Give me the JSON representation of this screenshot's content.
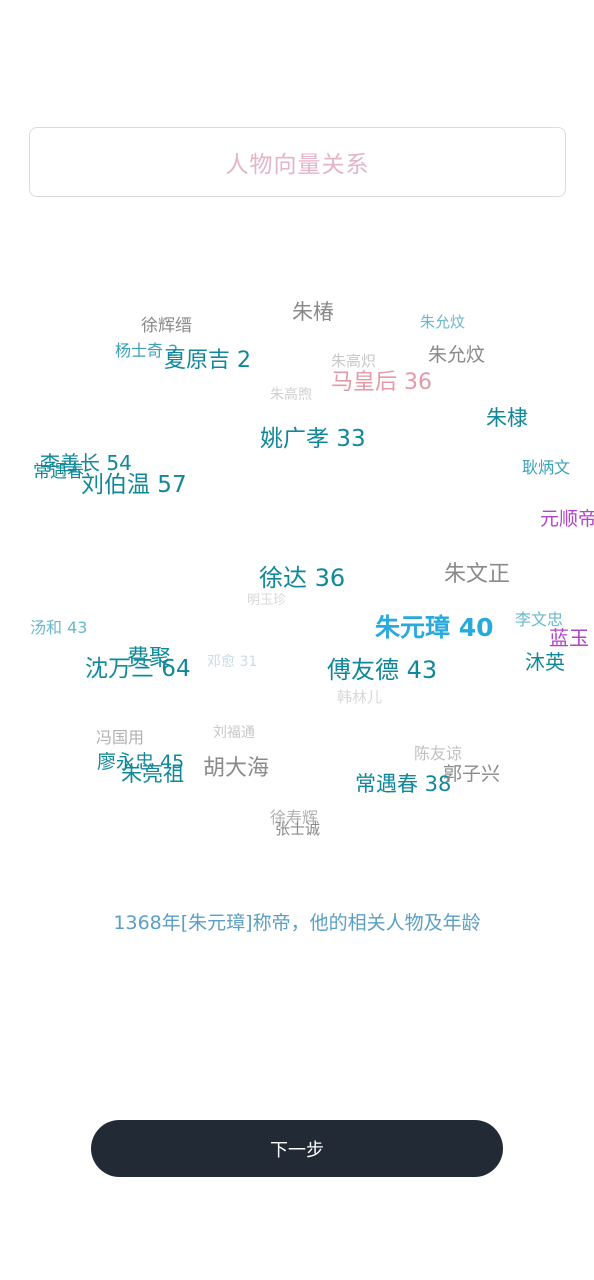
{
  "header": {
    "title": "人物向量关系"
  },
  "caption": "1368年[朱元璋]称帝，他的相关人物及年龄",
  "next_button": {
    "label": "下一步"
  },
  "word_cloud": [
    {
      "text": "朱椿",
      "color": "#8a8a8a"
    },
    {
      "text": "徐辉缙",
      "color": "#8a8a8a"
    },
    {
      "text": "杨士奇 2",
      "color": "#3aa1b8"
    },
    {
      "text": "夏原吉 2",
      "color": "#10889a"
    },
    {
      "text": "朱允炆",
      "color": "#6ab8cc"
    },
    {
      "text": "朱允炆",
      "color": "#8a8a8a"
    },
    {
      "text": "朱高炽",
      "color": "#c8c8c8"
    },
    {
      "text": "马皇后 36",
      "color": "#e39aa8"
    },
    {
      "text": "朱高煦",
      "color": "#d0d0d0"
    },
    {
      "text": "朱棣",
      "color": "#10889a"
    },
    {
      "text": "姚广孝 33",
      "color": "#10889a"
    },
    {
      "text": "李善长 54",
      "color": "#10889a"
    },
    {
      "text": "常遇春",
      "color": "#10889a"
    },
    {
      "text": "刘伯温 57",
      "color": "#10889a"
    },
    {
      "text": "耿炳文",
      "color": "#3aa1b8"
    },
    {
      "text": "元顺帝",
      "color": "#b244c8"
    },
    {
      "text": "徐达 36",
      "color": "#10889a"
    },
    {
      "text": "朱文正",
      "color": "#8a8a8a"
    },
    {
      "text": "明玉珍",
      "color": "#d8d8d8"
    },
    {
      "text": "汤和 43",
      "color": "#6ab8cc"
    },
    {
      "text": "朱元璋 40",
      "color": "#28aadc"
    },
    {
      "text": "李文忠",
      "color": "#6ab8cc"
    },
    {
      "text": "蓝玉",
      "color": "#b244c8"
    },
    {
      "text": "费聚",
      "color": "#10889a"
    },
    {
      "text": "沈万三 64",
      "color": "#10889a"
    },
    {
      "text": "邓愈 31",
      "color": "#c8dce6"
    },
    {
      "text": "傅友德 43",
      "color": "#10889a"
    },
    {
      "text": "沐英",
      "color": "#10889a"
    },
    {
      "text": "韩林儿",
      "color": "#d8d8d8"
    },
    {
      "text": "冯国用",
      "color": "#b0b0b0"
    },
    {
      "text": "刘福通",
      "color": "#c8c8c8"
    },
    {
      "text": "廖永忠 45",
      "color": "#10889a"
    },
    {
      "text": "朱亮祖",
      "color": "#10889a"
    },
    {
      "text": "胡大海",
      "color": "#8a8a8a"
    },
    {
      "text": "陈友谅",
      "color": "#c0c0c0"
    },
    {
      "text": "常遇春 38",
      "color": "#10889a"
    },
    {
      "text": "郭子兴",
      "color": "#8a8a8a"
    },
    {
      "text": "徐寿辉",
      "color": "#b0b0b0"
    },
    {
      "text": "张士诚",
      "color": "#8a8a8a"
    }
  ]
}
